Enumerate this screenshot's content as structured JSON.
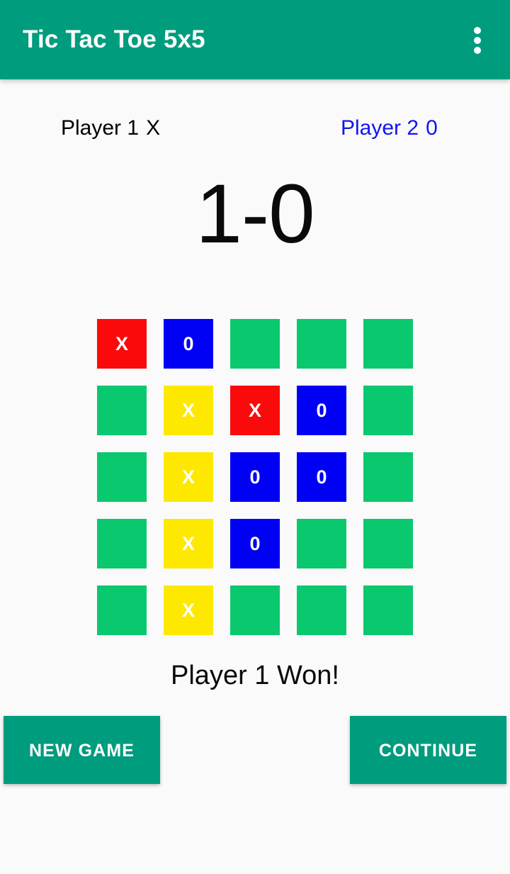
{
  "app": {
    "title": "Tic Tac Toe 5x5",
    "bar_color": "#009c7e",
    "background_color": "#fafafa",
    "overflow_icon": "more-vert-icon"
  },
  "players": {
    "player1": {
      "name": "Player 1",
      "mark": "X",
      "color": "#000000"
    },
    "player2": {
      "name": "Player 2",
      "mark": "0",
      "color": "#1414f0"
    }
  },
  "score": {
    "text": "1-0",
    "player1_score": 1,
    "player2_score": 0
  },
  "board": {
    "rows": 5,
    "cols": 5,
    "colors": {
      "empty": "#0ac86e",
      "x": "#fa0a0a",
      "o": "#0000f5",
      "win": "#ffe800"
    },
    "cells": [
      [
        {
          "mark": "X",
          "state": "x"
        },
        {
          "mark": "0",
          "state": "o"
        },
        {
          "mark": "",
          "state": "empty"
        },
        {
          "mark": "",
          "state": "empty"
        },
        {
          "mark": "",
          "state": "empty"
        }
      ],
      [
        {
          "mark": "",
          "state": "empty"
        },
        {
          "mark": "X",
          "state": "win"
        },
        {
          "mark": "X",
          "state": "x"
        },
        {
          "mark": "0",
          "state": "o"
        },
        {
          "mark": "",
          "state": "empty"
        }
      ],
      [
        {
          "mark": "",
          "state": "empty"
        },
        {
          "mark": "X",
          "state": "win"
        },
        {
          "mark": "0",
          "state": "o"
        },
        {
          "mark": "0",
          "state": "o"
        },
        {
          "mark": "",
          "state": "empty"
        }
      ],
      [
        {
          "mark": "",
          "state": "empty"
        },
        {
          "mark": "X",
          "state": "win"
        },
        {
          "mark": "0",
          "state": "o"
        },
        {
          "mark": "",
          "state": "empty"
        },
        {
          "mark": "",
          "state": "empty"
        }
      ],
      [
        {
          "mark": "",
          "state": "empty"
        },
        {
          "mark": "X",
          "state": "win"
        },
        {
          "mark": "",
          "state": "empty"
        },
        {
          "mark": "",
          "state": "empty"
        },
        {
          "mark": "",
          "state": "empty"
        }
      ]
    ]
  },
  "result": {
    "text": "Player 1 Won!"
  },
  "buttons": {
    "new_game": "NEW GAME",
    "continue": "CONTINUE"
  }
}
